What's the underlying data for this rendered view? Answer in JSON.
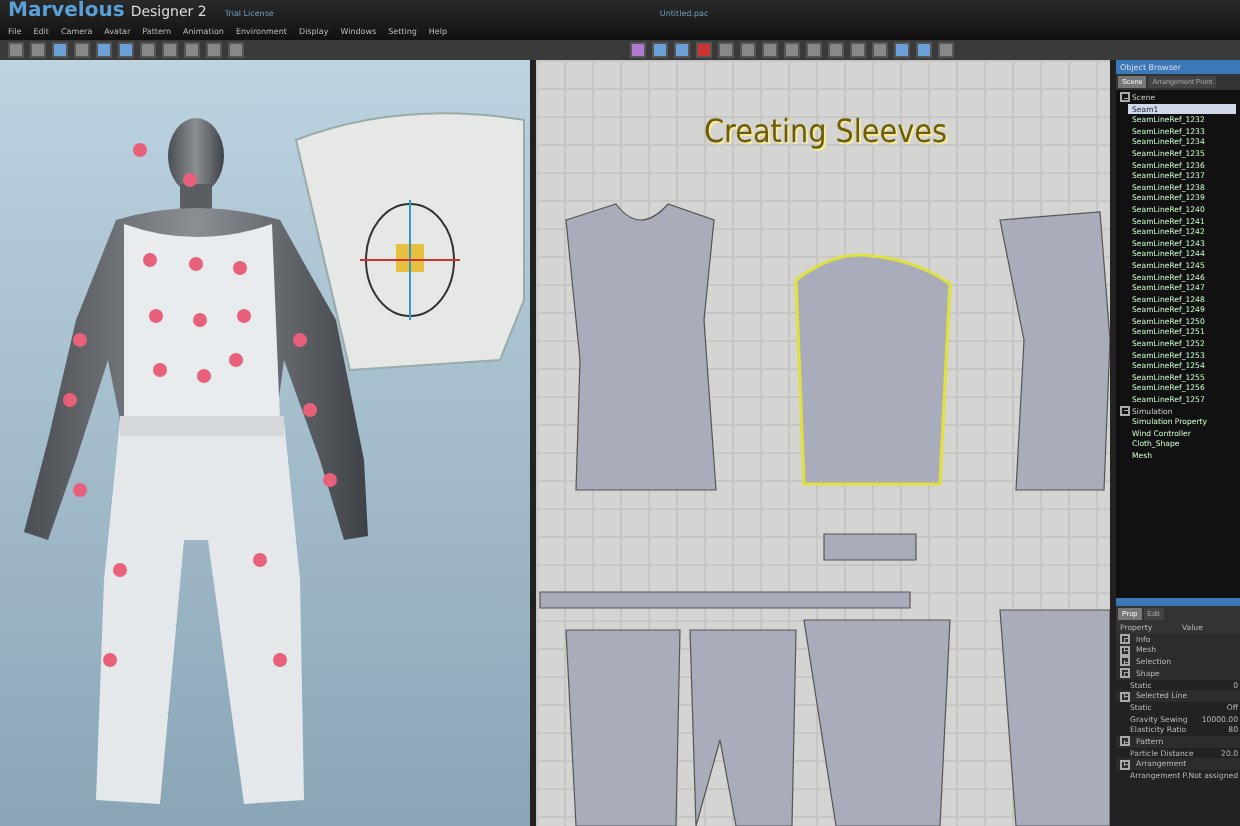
{
  "window": {
    "app_name": "Marvelous",
    "app_version": "Designer 2",
    "license": "Trial License",
    "file": "Untitled.pac"
  },
  "menu": [
    "File",
    "Edit",
    "Camera",
    "Avatar",
    "Pattern",
    "Animation",
    "Environment",
    "Display",
    "Windows",
    "Setting",
    "Help"
  ],
  "viewport_2d": {
    "caption": "Creating Sleeves"
  },
  "object_browser": {
    "title": "Object Browser",
    "tabs": [
      {
        "label": "Scene",
        "selected": true
      },
      {
        "label": "Arrangement Point",
        "selected": false
      }
    ],
    "tree": [
      {
        "label": "Scene",
        "expanded": true,
        "children": [
          {
            "label": "Seam1",
            "selected": true
          },
          {
            "label": "SeamLineRef_1232",
            "selected": false
          },
          {
            "label": "SeamLineRef_1233",
            "selected": false
          },
          {
            "label": "SeamLineRef_1234",
            "selected": false
          },
          {
            "label": "SeamLineRef_1235",
            "selected": false
          },
          {
            "label": "SeamLineRef_1236",
            "selected": false
          },
          {
            "label": "SeamLineRef_1237",
            "selected": false
          },
          {
            "label": "SeamLineRef_1238",
            "selected": false
          },
          {
            "label": "SeamLineRef_1239",
            "selected": false
          },
          {
            "label": "SeamLineRef_1240",
            "selected": false
          },
          {
            "label": "SeamLineRef_1241",
            "selected": false
          },
          {
            "label": "SeamLineRef_1242",
            "selected": false
          },
          {
            "label": "SeamLineRef_1243",
            "selected": false
          },
          {
            "label": "SeamLineRef_1244",
            "selected": false
          },
          {
            "label": "SeamLineRef_1245",
            "selected": false
          },
          {
            "label": "SeamLineRef_1246",
            "selected": false
          },
          {
            "label": "SeamLineRef_1247",
            "selected": false
          },
          {
            "label": "SeamLineRef_1248",
            "selected": false
          },
          {
            "label": "SeamLineRef_1249",
            "selected": false
          },
          {
            "label": "SeamLineRef_1250",
            "selected": false
          },
          {
            "label": "SeamLineRef_1251",
            "selected": false
          },
          {
            "label": "SeamLineRef_1252",
            "selected": false
          },
          {
            "label": "SeamLineRef_1253",
            "selected": false
          },
          {
            "label": "SeamLineRef_1254",
            "selected": false
          },
          {
            "label": "SeamLineRef_1255",
            "selected": false
          },
          {
            "label": "SeamLineRef_1256",
            "selected": false
          },
          {
            "label": "SeamLineRef_1257",
            "selected": false
          }
        ]
      },
      {
        "label": "Simulation",
        "expanded": true,
        "children": [
          {
            "label": "Simulation Property",
            "selected": false
          },
          {
            "label": "Wind Controller",
            "selected": false
          },
          {
            "label": "Cloth_Shape",
            "selected": false
          },
          {
            "label": "Mesh",
            "selected": false
          }
        ]
      }
    ]
  },
  "property_editor": {
    "tabs": [
      {
        "label": "Prop",
        "selected": true
      },
      {
        "label": "Edit",
        "selected": false
      }
    ],
    "columns": [
      "Property",
      "Value"
    ],
    "rows": [
      {
        "kind": "section",
        "name": "Info"
      },
      {
        "kind": "section",
        "name": "Mesh"
      },
      {
        "kind": "section",
        "name": "Selection"
      },
      {
        "kind": "section",
        "name": "Shape"
      },
      {
        "kind": "field",
        "name": "Static",
        "value": "0"
      },
      {
        "kind": "section",
        "name": "Selected Line"
      },
      {
        "kind": "field",
        "name": "Static",
        "value": "Off"
      },
      {
        "kind": "field",
        "name": "Gravity Sewing",
        "value": "10000.00"
      },
      {
        "kind": "field",
        "name": "Elasticity Ratio",
        "value": "80"
      },
      {
        "kind": "section",
        "name": "Pattern"
      },
      {
        "kind": "field",
        "name": "Particle Distance",
        "value": "20.0"
      },
      {
        "kind": "section",
        "name": "Arrangement"
      },
      {
        "kind": "field",
        "name": "Arrangement P.",
        "value": "Not assigned"
      }
    ]
  }
}
